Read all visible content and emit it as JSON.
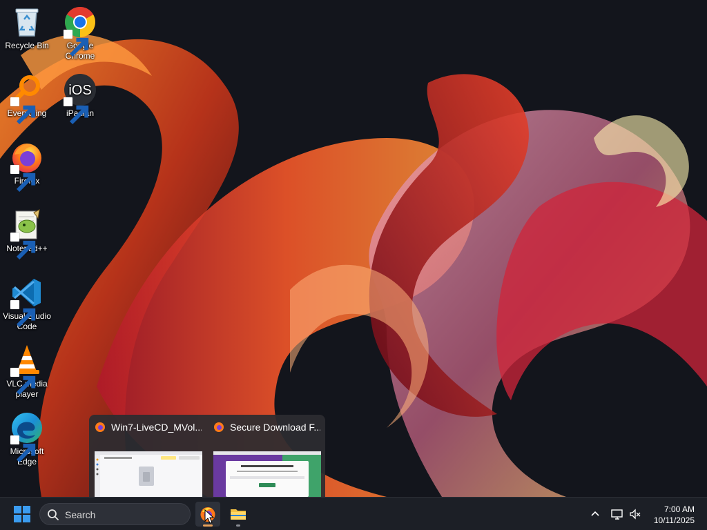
{
  "desktop": {
    "icons": [
      {
        "label": "Recycle Bin",
        "icon": "recycle-bin-icon"
      },
      {
        "label": "Google Chrome",
        "icon": "chrome-icon"
      },
      {
        "label": "Everything",
        "icon": "everything-icon"
      },
      {
        "label": "iPadian",
        "icon": "ipadian-icon",
        "glyph": "iOS"
      },
      {
        "label": "Firefox",
        "icon": "firefox-icon"
      },
      {
        "label": "Notepad++",
        "icon": "notepad-plus-plus-icon"
      },
      {
        "label": "Visual Studio Code",
        "icon": "vscode-icon"
      },
      {
        "label": "VLC media player",
        "icon": "vlc-icon"
      },
      {
        "label": "Microsoft Edge",
        "icon": "edge-icon"
      }
    ]
  },
  "preview": {
    "windows": [
      {
        "title": "Win7-LiveCD_MVol...",
        "icon": "firefox-icon"
      },
      {
        "title": "Secure Download F...",
        "icon": "firefox-icon"
      }
    ]
  },
  "taskbar": {
    "search_placeholder": "Search",
    "apps": [
      {
        "name": "Firefox",
        "icon": "firefox-icon",
        "active": true
      },
      {
        "name": "File Explorer",
        "icon": "folder-icon",
        "active": false
      }
    ],
    "tray": [
      "chevron-up-icon",
      "network-icon",
      "volume-muted-icon"
    ],
    "time": "7:00 AM",
    "date": "10/11/2025"
  },
  "colors": {
    "taskbar_bg": "#1c1f26",
    "accent": "#e8a25b",
    "windows_blue": "#3b9cf0"
  }
}
